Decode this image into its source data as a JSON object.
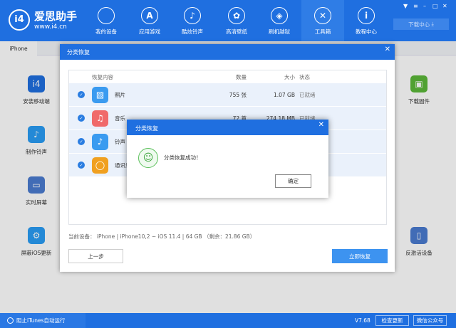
{
  "app": {
    "name": "爱思助手",
    "url": "www.i4.cn",
    "download_center": "下载中心"
  },
  "nav": [
    {
      "label": "我的设备",
      "icon": "apple-icon"
    },
    {
      "label": "应用游戏",
      "icon": "app-store-icon"
    },
    {
      "label": "酷炫铃声",
      "icon": "bell-icon"
    },
    {
      "label": "高清壁纸",
      "icon": "flower-icon"
    },
    {
      "label": "刷机越狱",
      "icon": "box-icon"
    },
    {
      "label": "工具箱",
      "icon": "tools-icon"
    },
    {
      "label": "教程中心",
      "icon": "info-icon"
    }
  ],
  "tab": "iPhone",
  "tools_left": [
    "安装移动端",
    "制作铃声",
    "实时屏幕",
    "屏蔽iOS更新"
  ],
  "tools_right": [
    "下载固件",
    "反激活设备"
  ],
  "dialog": {
    "title": "分类恢复",
    "headers": {
      "content": "恢复内容",
      "count": "数量",
      "size": "大小",
      "status": "状态"
    },
    "rows": [
      {
        "name": "照片",
        "count": "755 张",
        "size": "1.07 GB",
        "status": "已就绪",
        "color": "#3a9bf0"
      },
      {
        "name": "音乐",
        "count": "72 首",
        "size": "274.18 MB",
        "status": "已就绪",
        "color": "#f06a6a"
      },
      {
        "name": "铃声",
        "count": "",
        "size": "",
        "status": "",
        "color": "#3a9bf0"
      },
      {
        "name": "通讯录",
        "count": "",
        "size": "",
        "status": "",
        "color": "#f0a020"
      }
    ],
    "device_info": "当前设备： iPhone   |   iPhone10,2 ~ iOS 11.4   |   64 GB （剩余：21.86 GB）",
    "prev": "上一步",
    "restore": "立即恢复"
  },
  "alert": {
    "title": "分类恢复",
    "message": "分类恢复成功！",
    "ok": "确定"
  },
  "footer": {
    "itunes": "阻止iTunes自动运行",
    "version": "V7.68",
    "check_update": "检查更新",
    "wechat": "微信公众号"
  }
}
